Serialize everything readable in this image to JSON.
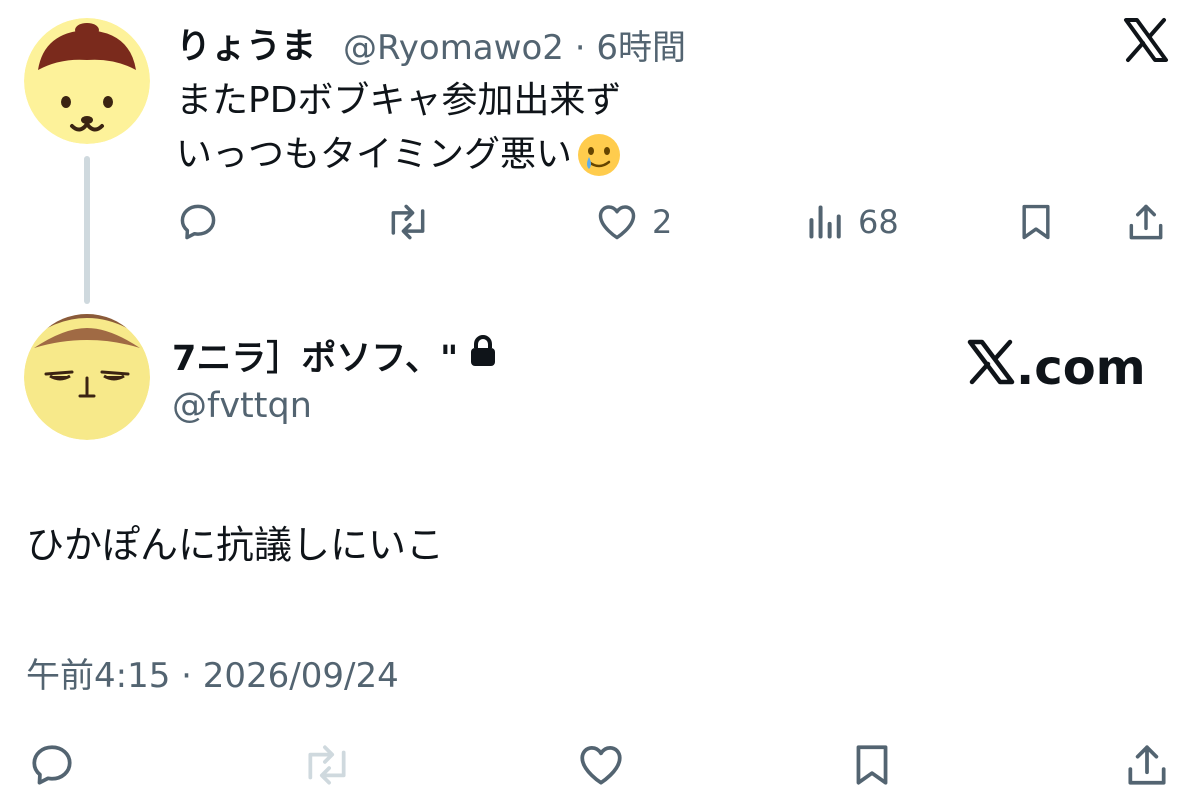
{
  "original_tweet": {
    "display_name": "りょうま",
    "handle": "@Ryomawo2",
    "separator": "·",
    "time_ago": "6時間",
    "text_line1": "またPDボブキャ参加出来ず",
    "text_line2": "いっつもタイミング悪い",
    "emoji": "🥲",
    "actions": {
      "reply_icon": "reply-icon",
      "retweet_icon": "retweet-icon",
      "like_count": "2",
      "views_count": "68"
    }
  },
  "reply_tweet": {
    "display_name": "7ニラ］ポソフ、\"",
    "handle": "@fvttqn",
    "locked": true,
    "text": "ひかぽんに抗議しにいこ",
    "timestamp": "午前4:15 · 2026/09/24"
  },
  "branding": {
    "x_logo": "x-logo-icon",
    "xcom_suffix": ".com"
  },
  "colors": {
    "text": "#0f1419",
    "muted": "#536471",
    "thread_line": "#cfd9de",
    "retweet_disabled": "#cfd9de"
  }
}
